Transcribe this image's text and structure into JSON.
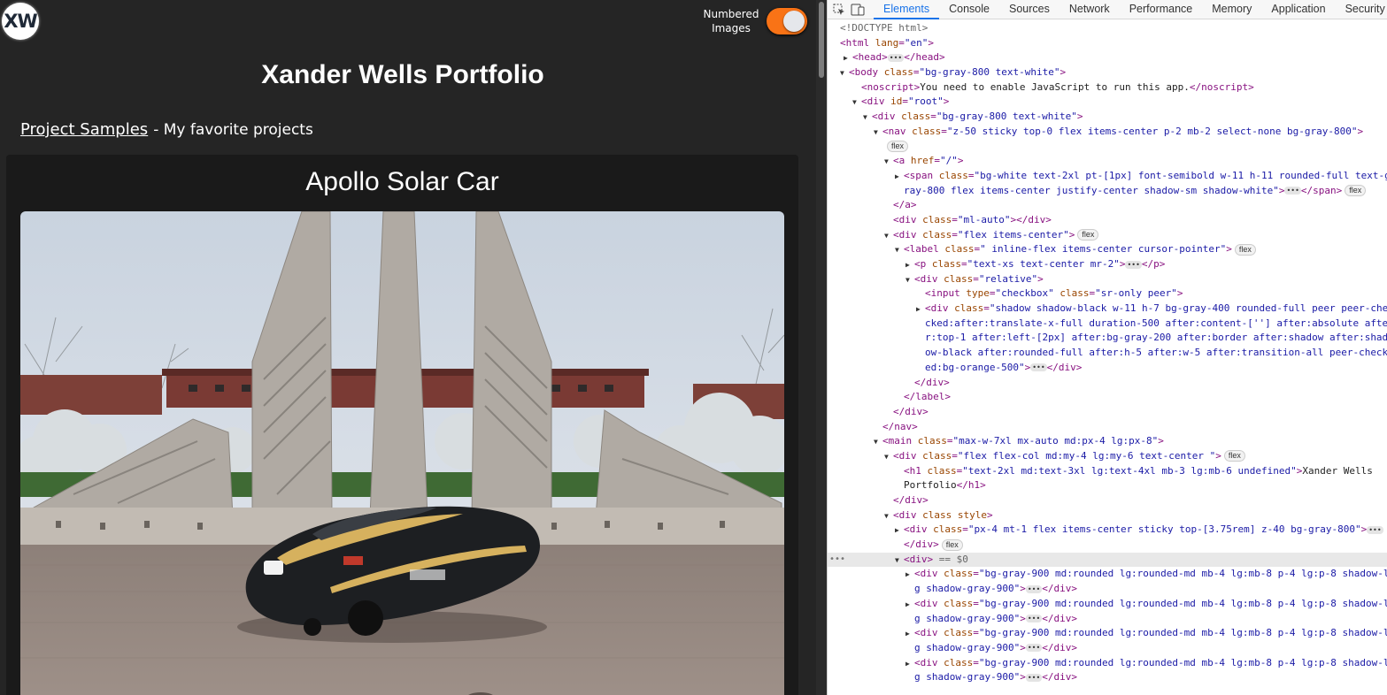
{
  "site": {
    "logo_text": "XW",
    "toggle_label": "Numbered Images",
    "toggle_on": true,
    "title": "Xander Wells Portfolio",
    "section_link": "Project Samples",
    "section_desc": "- My favorite projects",
    "project_title": "Apollo Solar Car"
  },
  "devtools": {
    "tabs": [
      "Elements",
      "Console",
      "Sources",
      "Network",
      "Performance",
      "Memory",
      "Application",
      "Security"
    ],
    "active_tab": "Elements",
    "accent": "#1a73e8"
  },
  "colors": {
    "accent_orange": "#f97316",
    "page_bg": "#252525",
    "card_bg": "#1a1a1a"
  }
}
